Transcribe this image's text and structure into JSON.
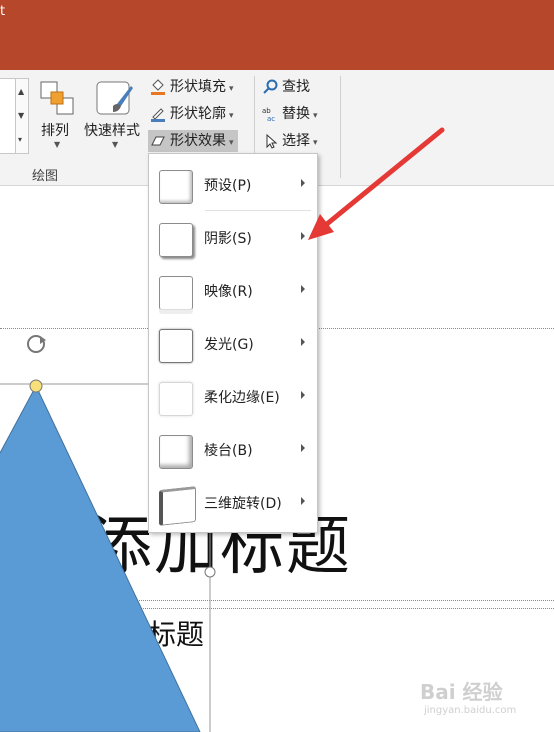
{
  "window": {
    "title_fragment": "t"
  },
  "ribbon": {
    "arrange_label": "排列",
    "quick_styles_label": "快速样式",
    "shape_fill_label": "形状填充",
    "shape_outline_label": "形状轮廓",
    "shape_effects_label": "形状效果",
    "find_label": "查找",
    "replace_label": "替换",
    "select_label": "选择",
    "drawing_group_label": "绘图"
  },
  "effects_menu": {
    "items": [
      {
        "label": "预设(P)",
        "icon": "preset-thumb"
      },
      {
        "label": "阴影(S)",
        "icon": "shadow-thumb"
      },
      {
        "label": "映像(R)",
        "icon": "reflection-thumb"
      },
      {
        "label": "发光(G)",
        "icon": "glow-thumb"
      },
      {
        "label": "柔化边缘(E)",
        "icon": "soft-edges-thumb"
      },
      {
        "label": "棱台(B)",
        "icon": "bevel-thumb"
      },
      {
        "label": "三维旋转(D)",
        "icon": "3d-rotation-thumb"
      }
    ]
  },
  "slide": {
    "title_text": "添加标题",
    "subtitle_text": "标题"
  },
  "watermark": {
    "line1": "Bai 经验",
    "line2": "jingyan.baidu.com"
  },
  "colors": {
    "title_bar": "#b7472a",
    "triangle_fill": "#5b9bd5",
    "annotation_arrow": "#e53935"
  }
}
